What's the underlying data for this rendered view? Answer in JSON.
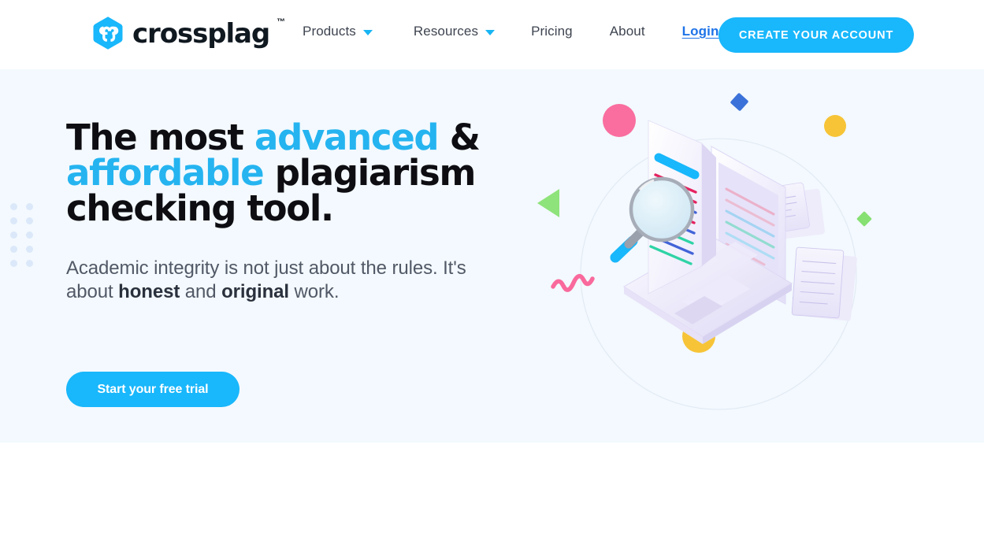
{
  "brand": {
    "name": "crossplag",
    "trademark": "™",
    "logo_icon": "crossplag-hexagon-logo",
    "logo_color": "#19b7fb"
  },
  "header": {
    "nav": [
      {
        "label": "Products",
        "icon": "chevron-down-icon",
        "has_caret": true
      },
      {
        "label": "Resources",
        "icon": "chevron-down-icon",
        "has_caret": true
      },
      {
        "label": "Pricing",
        "has_caret": false
      },
      {
        "label": "About",
        "has_caret": false
      },
      {
        "label": "Login",
        "has_caret": false,
        "style": "link-underlined"
      }
    ],
    "cta_label": "CREATE YOUR ACCOUNT",
    "cta_color": "#19b7fb",
    "background": "#ffffff"
  },
  "hero": {
    "background": "#f3f9fe",
    "headline": {
      "line1_a": "The most ",
      "line1_accent": "advanced",
      "line1_b": " &",
      "line2_accent": "affordable",
      "line2_b": " plagiarism",
      "line3": "checking tool.",
      "accent_color": "#25b4f0",
      "text_color": "#0d0d12"
    },
    "subhead": {
      "part1": "Academic integrity is not just about the rules. It's about ",
      "bold1": "honest",
      "part2": " and ",
      "bold2": "original",
      "part3": " work."
    },
    "cta_label": "Start your free trial",
    "cta_color": "#19b7fb",
    "dot_grid": {
      "icon": "dot-grid-decoration",
      "columns": 2,
      "rows": 5,
      "color": "#dbe8fa"
    },
    "illustration": {
      "name": "plagiarism-checker-illustration",
      "elements": [
        {
          "name": "laptop",
          "color": "#e8e6fb"
        },
        {
          "name": "document-page",
          "color": "#f7f6fe"
        },
        {
          "name": "magnifying-glass",
          "lens": "#dbeef8",
          "handle": "#19b7fb",
          "rim": "#9aa0ac"
        },
        {
          "name": "floating-paper-top",
          "color": "#eceafb"
        },
        {
          "name": "floating-paper-bottom",
          "color": "#eceafb"
        },
        {
          "name": "pink-circle",
          "color": "#f96e9e"
        },
        {
          "name": "yellow-circle-top",
          "color": "#f7c437"
        },
        {
          "name": "yellow-circle-bottom",
          "color": "#f7c437"
        },
        {
          "name": "blue-circle",
          "color": "#1ca5f0"
        },
        {
          "name": "blue-diamond",
          "color": "#3b72d9"
        },
        {
          "name": "green-diamond",
          "color": "#87e072"
        },
        {
          "name": "green-triangle",
          "color": "#8ee37a"
        },
        {
          "name": "pink-squiggle",
          "color": "#f9699c"
        },
        {
          "name": "orbit-ellipse",
          "color": "#e3eaf4"
        }
      ],
      "document_line_colors": [
        "#19b7fb",
        "#e5225f",
        "#e5225f",
        "#4263d8",
        "#e5225f",
        "#4263d8",
        "#2fd3a5",
        "#4263d8",
        "#2fd3a5"
      ]
    }
  }
}
